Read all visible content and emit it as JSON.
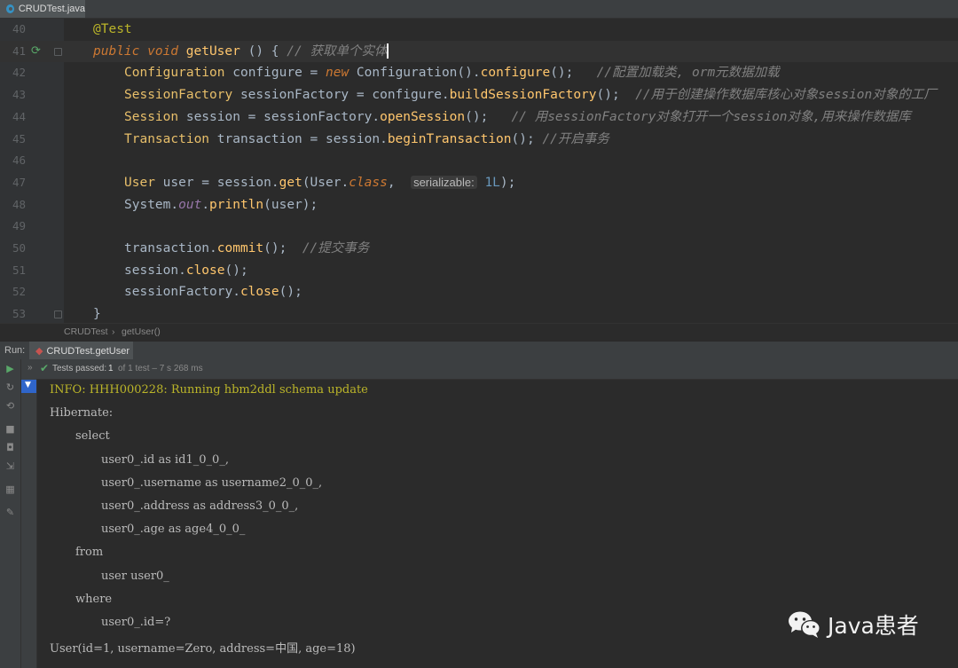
{
  "tab": {
    "file": "CRUDTest.java"
  },
  "editor": {
    "lines": [
      {
        "n": "40",
        "tokens": [
          {
            "t": "@Test",
            "c": "ann"
          }
        ]
      },
      {
        "n": "41",
        "current": true,
        "tokens": [
          {
            "t": "public ",
            "c": "kw"
          },
          {
            "t": "void ",
            "c": "kw"
          },
          {
            "t": "getUser",
            "c": "fn"
          },
          {
            "t": " () { ",
            "c": ""
          },
          {
            "t": "// 获取单个实体",
            "c": "cm"
          }
        ]
      },
      {
        "n": "42",
        "indent": 1,
        "tokens": [
          {
            "t": "Configuration",
            "c": "cls"
          },
          {
            "t": " configure = ",
            "c": ""
          },
          {
            "t": "new ",
            "c": "kw"
          },
          {
            "t": "Configuration().",
            "c": ""
          },
          {
            "t": "configure",
            "c": "fn"
          },
          {
            "t": "();   ",
            "c": ""
          },
          {
            "t": "//配置加载类, orm元数据加载",
            "c": "cm"
          }
        ]
      },
      {
        "n": "43",
        "indent": 1,
        "tokens": [
          {
            "t": "SessionFactory",
            "c": "cls"
          },
          {
            "t": " sessionFactory = configure.",
            "c": ""
          },
          {
            "t": "buildSessionFactory",
            "c": "fn"
          },
          {
            "t": "();  ",
            "c": ""
          },
          {
            "t": "//用于创建操作数据库核心对象session对象的工厂",
            "c": "cm"
          }
        ]
      },
      {
        "n": "44",
        "indent": 1,
        "tokens": [
          {
            "t": "Session",
            "c": "cls"
          },
          {
            "t": " session = sessionFactory.",
            "c": ""
          },
          {
            "t": "openSession",
            "c": "fn"
          },
          {
            "t": "();   ",
            "c": ""
          },
          {
            "t": "// 用sessionFactory对象打开一个session对象,用来操作数据库",
            "c": "cm"
          }
        ]
      },
      {
        "n": "45",
        "indent": 1,
        "tokens": [
          {
            "t": "Transaction",
            "c": "cls"
          },
          {
            "t": " transaction = session.",
            "c": ""
          },
          {
            "t": "beginTransaction",
            "c": "fn"
          },
          {
            "t": "(); ",
            "c": ""
          },
          {
            "t": "//开启事务",
            "c": "cm"
          }
        ]
      },
      {
        "n": "46",
        "tokens": []
      },
      {
        "n": "47",
        "indent": 1,
        "tokens": [
          {
            "t": "User",
            "c": "cls"
          },
          {
            "t": " user = session.",
            "c": ""
          },
          {
            "t": "get",
            "c": "fn"
          },
          {
            "t": "(User.",
            "c": ""
          },
          {
            "t": "class",
            "c": "kwi"
          },
          {
            "t": ",  ",
            "c": ""
          },
          {
            "t": "serializable:",
            "c": "hint"
          },
          {
            "t": " ",
            "c": ""
          },
          {
            "t": "1L",
            "c": "num"
          },
          {
            "t": ");",
            "c": ""
          }
        ]
      },
      {
        "n": "48",
        "indent": 1,
        "tokens": [
          {
            "t": "System.",
            "c": ""
          },
          {
            "t": "out",
            "c": "field"
          },
          {
            "t": ".",
            "c": ""
          },
          {
            "t": "println",
            "c": "fn"
          },
          {
            "t": "(user);",
            "c": ""
          }
        ]
      },
      {
        "n": "49",
        "tokens": []
      },
      {
        "n": "50",
        "indent": 1,
        "tokens": [
          {
            "t": "transaction.",
            "c": ""
          },
          {
            "t": "commit",
            "c": "fn"
          },
          {
            "t": "();  ",
            "c": ""
          },
          {
            "t": "//提交事务",
            "c": "cm"
          }
        ]
      },
      {
        "n": "51",
        "indent": 1,
        "tokens": [
          {
            "t": "session.",
            "c": ""
          },
          {
            "t": "close",
            "c": "fn"
          },
          {
            "t": "();",
            "c": ""
          }
        ]
      },
      {
        "n": "52",
        "indent": 1,
        "tokens": [
          {
            "t": "sessionFactory.",
            "c": ""
          },
          {
            "t": "close",
            "c": "fn"
          },
          {
            "t": "();",
            "c": ""
          }
        ]
      },
      {
        "n": "53",
        "tokens": [
          {
            "t": "}",
            "c": ""
          }
        ]
      }
    ]
  },
  "breadcrumb": {
    "cls": "CRUDTest",
    "sep": "›",
    "method": "getUser()"
  },
  "run": {
    "label": "Run:",
    "tab": "CRUDTest.getUser",
    "status_prefix": "Tests passed:",
    "status_count": "1",
    "status_rest": "of 1 test – 7 s 268 ms"
  },
  "console": {
    "lines": [
      {
        "text": "INFO: HHH000228: Running hbm2ddl schema update",
        "indent": 0,
        "info": true
      },
      {
        "text": "Hibernate:",
        "indent": 0
      },
      {
        "text": "select",
        "indent": 1
      },
      {
        "text": "user0_.id as id1_0_0_,",
        "indent": 2
      },
      {
        "text": "user0_.username as username2_0_0_,",
        "indent": 2
      },
      {
        "text": "user0_.address as address3_0_0_,",
        "indent": 2
      },
      {
        "text": "user0_.age as age4_0_0_",
        "indent": 2
      },
      {
        "text": "from",
        "indent": 1
      },
      {
        "text": "user user0_",
        "indent": 2
      },
      {
        "text": "where",
        "indent": 1
      },
      {
        "text": "user0_.id=?",
        "indent": 2
      },
      {
        "text": "User(id=1, username=Zero, address=中国, age=18)",
        "indent": 0
      }
    ]
  },
  "watermark": {
    "text": "Java患者",
    "icon": "wechat-icon"
  }
}
